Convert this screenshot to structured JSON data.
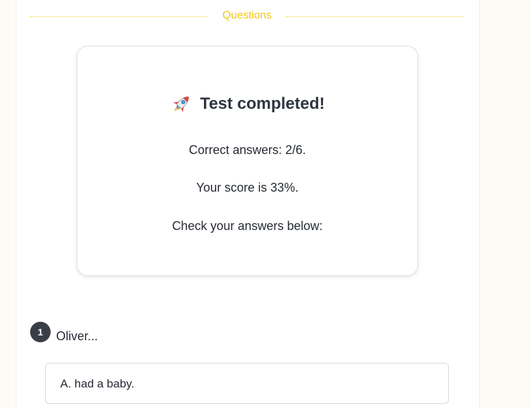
{
  "section": {
    "title": "Questions"
  },
  "result": {
    "title": "Test completed!",
    "icon": "rocket-icon",
    "correct_answers": "Correct answers: 2/6.",
    "score": "Your score is 33%.",
    "instruction": "Check your answers below:"
  },
  "questions": [
    {
      "number": "1",
      "text": "Oliver...",
      "options": [
        {
          "label": "A. had a baby."
        }
      ]
    }
  ],
  "colors": {
    "accent": "#f2c811",
    "badge": "#3a3f47",
    "text": "#262a33"
  }
}
